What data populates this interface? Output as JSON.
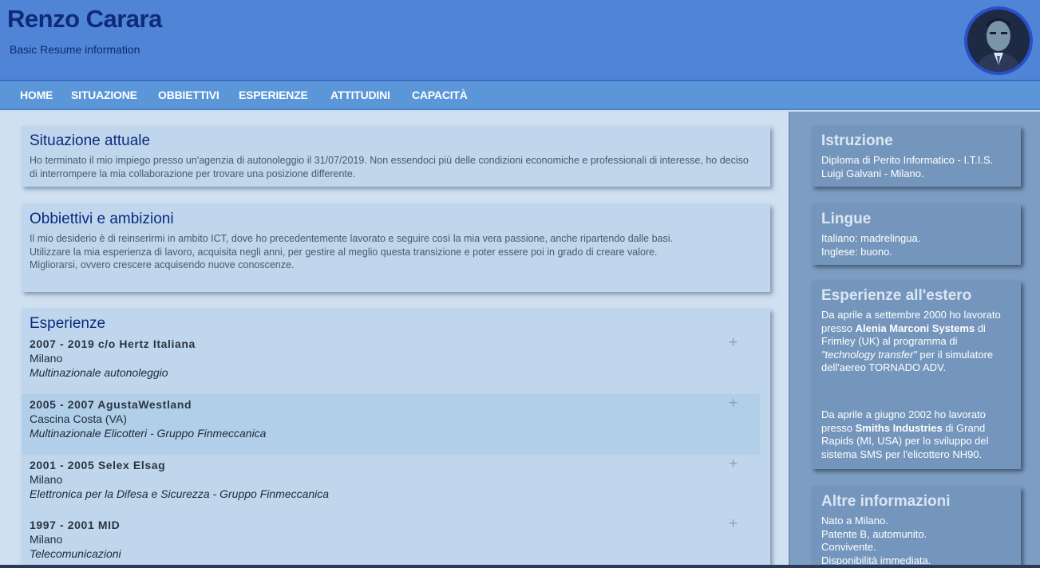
{
  "header": {
    "title": "Renzo Carara",
    "subtitle": "Basic Resume information"
  },
  "nav": {
    "items": [
      "HOME",
      "SITUAZIONE",
      "OBBIETTIVI",
      "ESPERIENZE",
      "ATTITUDINI",
      "CAPACITÀ"
    ]
  },
  "situazione": {
    "title": "Situazione attuale",
    "text": "Ho terminato il mio impiego presso un'agenzia di autonoleggio il 31/07/2019. Non essendoci più delle condizioni economiche e professionali di interesse, ho deciso di interrompere la mia collaborazione per trovare una posizione differente."
  },
  "obbiettivi": {
    "title": "Obbiettivi e ambizioni",
    "text1": "Il mio desiderio è di reinserirmi in ambito ICT, dove ho precedentemente lavorato e seguire così la mia vera passione, anche ripartendo dalle basi.",
    "text2": "Utilizzare la mia esperienza di lavoro, acquisita negli anni, per gestire al meglio questa transizione e poter essere poi in grado di creare valore.",
    "text3": "Migliorarsi, ovvero crescere acquisendo nuove conoscenze."
  },
  "esperienze": {
    "title": "Esperienze",
    "items": [
      {
        "title": "2007 - 2019 c/o Hertz Italiana",
        "place": "Milano",
        "desc": "Multinazionale autonoleggio",
        "expand": "+"
      },
      {
        "title": "2005 - 2007 AgustaWestland",
        "place": "Cascina Costa (VA)",
        "desc": "Multinazionale Elicotteri - Gruppo Finmeccanica",
        "expand": "+"
      },
      {
        "title": "2001 - 2005 Selex Elsag",
        "place": "Milano",
        "desc": "Elettronica per la Difesa e Sicurezza - Gruppo Finmeccanica",
        "expand": "+"
      },
      {
        "title": "1997 - 2001 MID",
        "place": "Milano",
        "desc": "Telecomunicazioni",
        "expand": "+"
      }
    ]
  },
  "sidebar": {
    "istruzione": {
      "title": "Istruzione",
      "text": "Diploma di Perito Informatico - I.T.I.S. Luigi Galvani - Milano."
    },
    "lingue": {
      "title": "Lingue",
      "line1": "Italiano: madrelingua.",
      "line2": "Inglese: buono."
    },
    "estero": {
      "title": "Esperienze all'estero",
      "p1_a": "Da aprile a settembre 2000 ho lavorato presso ",
      "p1_b": "Alenia Marconi Systems",
      "p1_c": " di Frimley (UK) al programma di ",
      "p1_d": "\"technology transfer\"",
      "p1_e": " per il simulatore dell'aereo TORNADO ADV.",
      "p2_a": "Da aprile a giugno 2002 ho lavorato presso ",
      "p2_b": "Smiths Industries",
      "p2_c": " di Grand Rapids (MI, USA) per lo sviluppo del sistema SMS per l'elicottero NH90."
    },
    "altre": {
      "title": "Altre informazioni",
      "line1": "Nato a Milano.",
      "line2": "Patente B, automunito.",
      "line3": "Convivente.",
      "line4": "Disponibilità immediata."
    }
  },
  "colors": {
    "header_bg": "#4f84d6",
    "nav_bg": "#5a96d8",
    "title_color": "#0f2a78",
    "sidebar_bg": "#7d9ec2"
  }
}
